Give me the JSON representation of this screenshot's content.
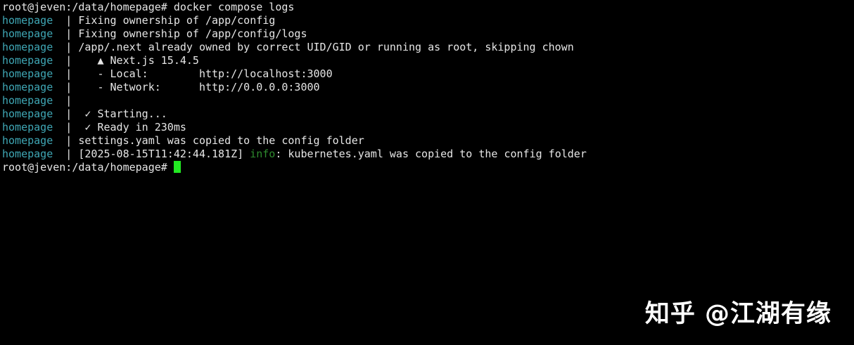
{
  "prompt_line": "root@jeven:/data/homepage# docker compose logs",
  "service_prefix": "homepage",
  "separator": "|",
  "log_lines": [
    {
      "message": "Fixing ownership of /app/config"
    },
    {
      "message": "Fixing ownership of /app/config/logs"
    },
    {
      "message": "/app/.next already owned by correct UID/GID or running as root, skipping chown"
    },
    {
      "message": "   ▲ Next.js 15.4.5"
    },
    {
      "message": "   - Local:        http://localhost:3000"
    },
    {
      "message": "   - Network:      http://0.0.0.0:3000"
    },
    {
      "message": ""
    },
    {
      "message": " ✓ Starting..."
    },
    {
      "message": " ✓ Ready in 230ms"
    },
    {
      "message": "settings.yaml was copied to the config folder"
    },
    {
      "timestamp": "[2025-08-15T11:42:44.181Z]",
      "level": "info",
      "message": ": kubernetes.yaml was copied to the config folder"
    }
  ],
  "final_prompt": "root@jeven:/data/homepage# ",
  "watermark": "知乎 @江湖有缘",
  "colors": {
    "background": "#000000",
    "text": "#e6e6e6",
    "service_prefix": "#3fa7b5",
    "info_level": "#2e8b2e",
    "cursor": "#22e822"
  }
}
